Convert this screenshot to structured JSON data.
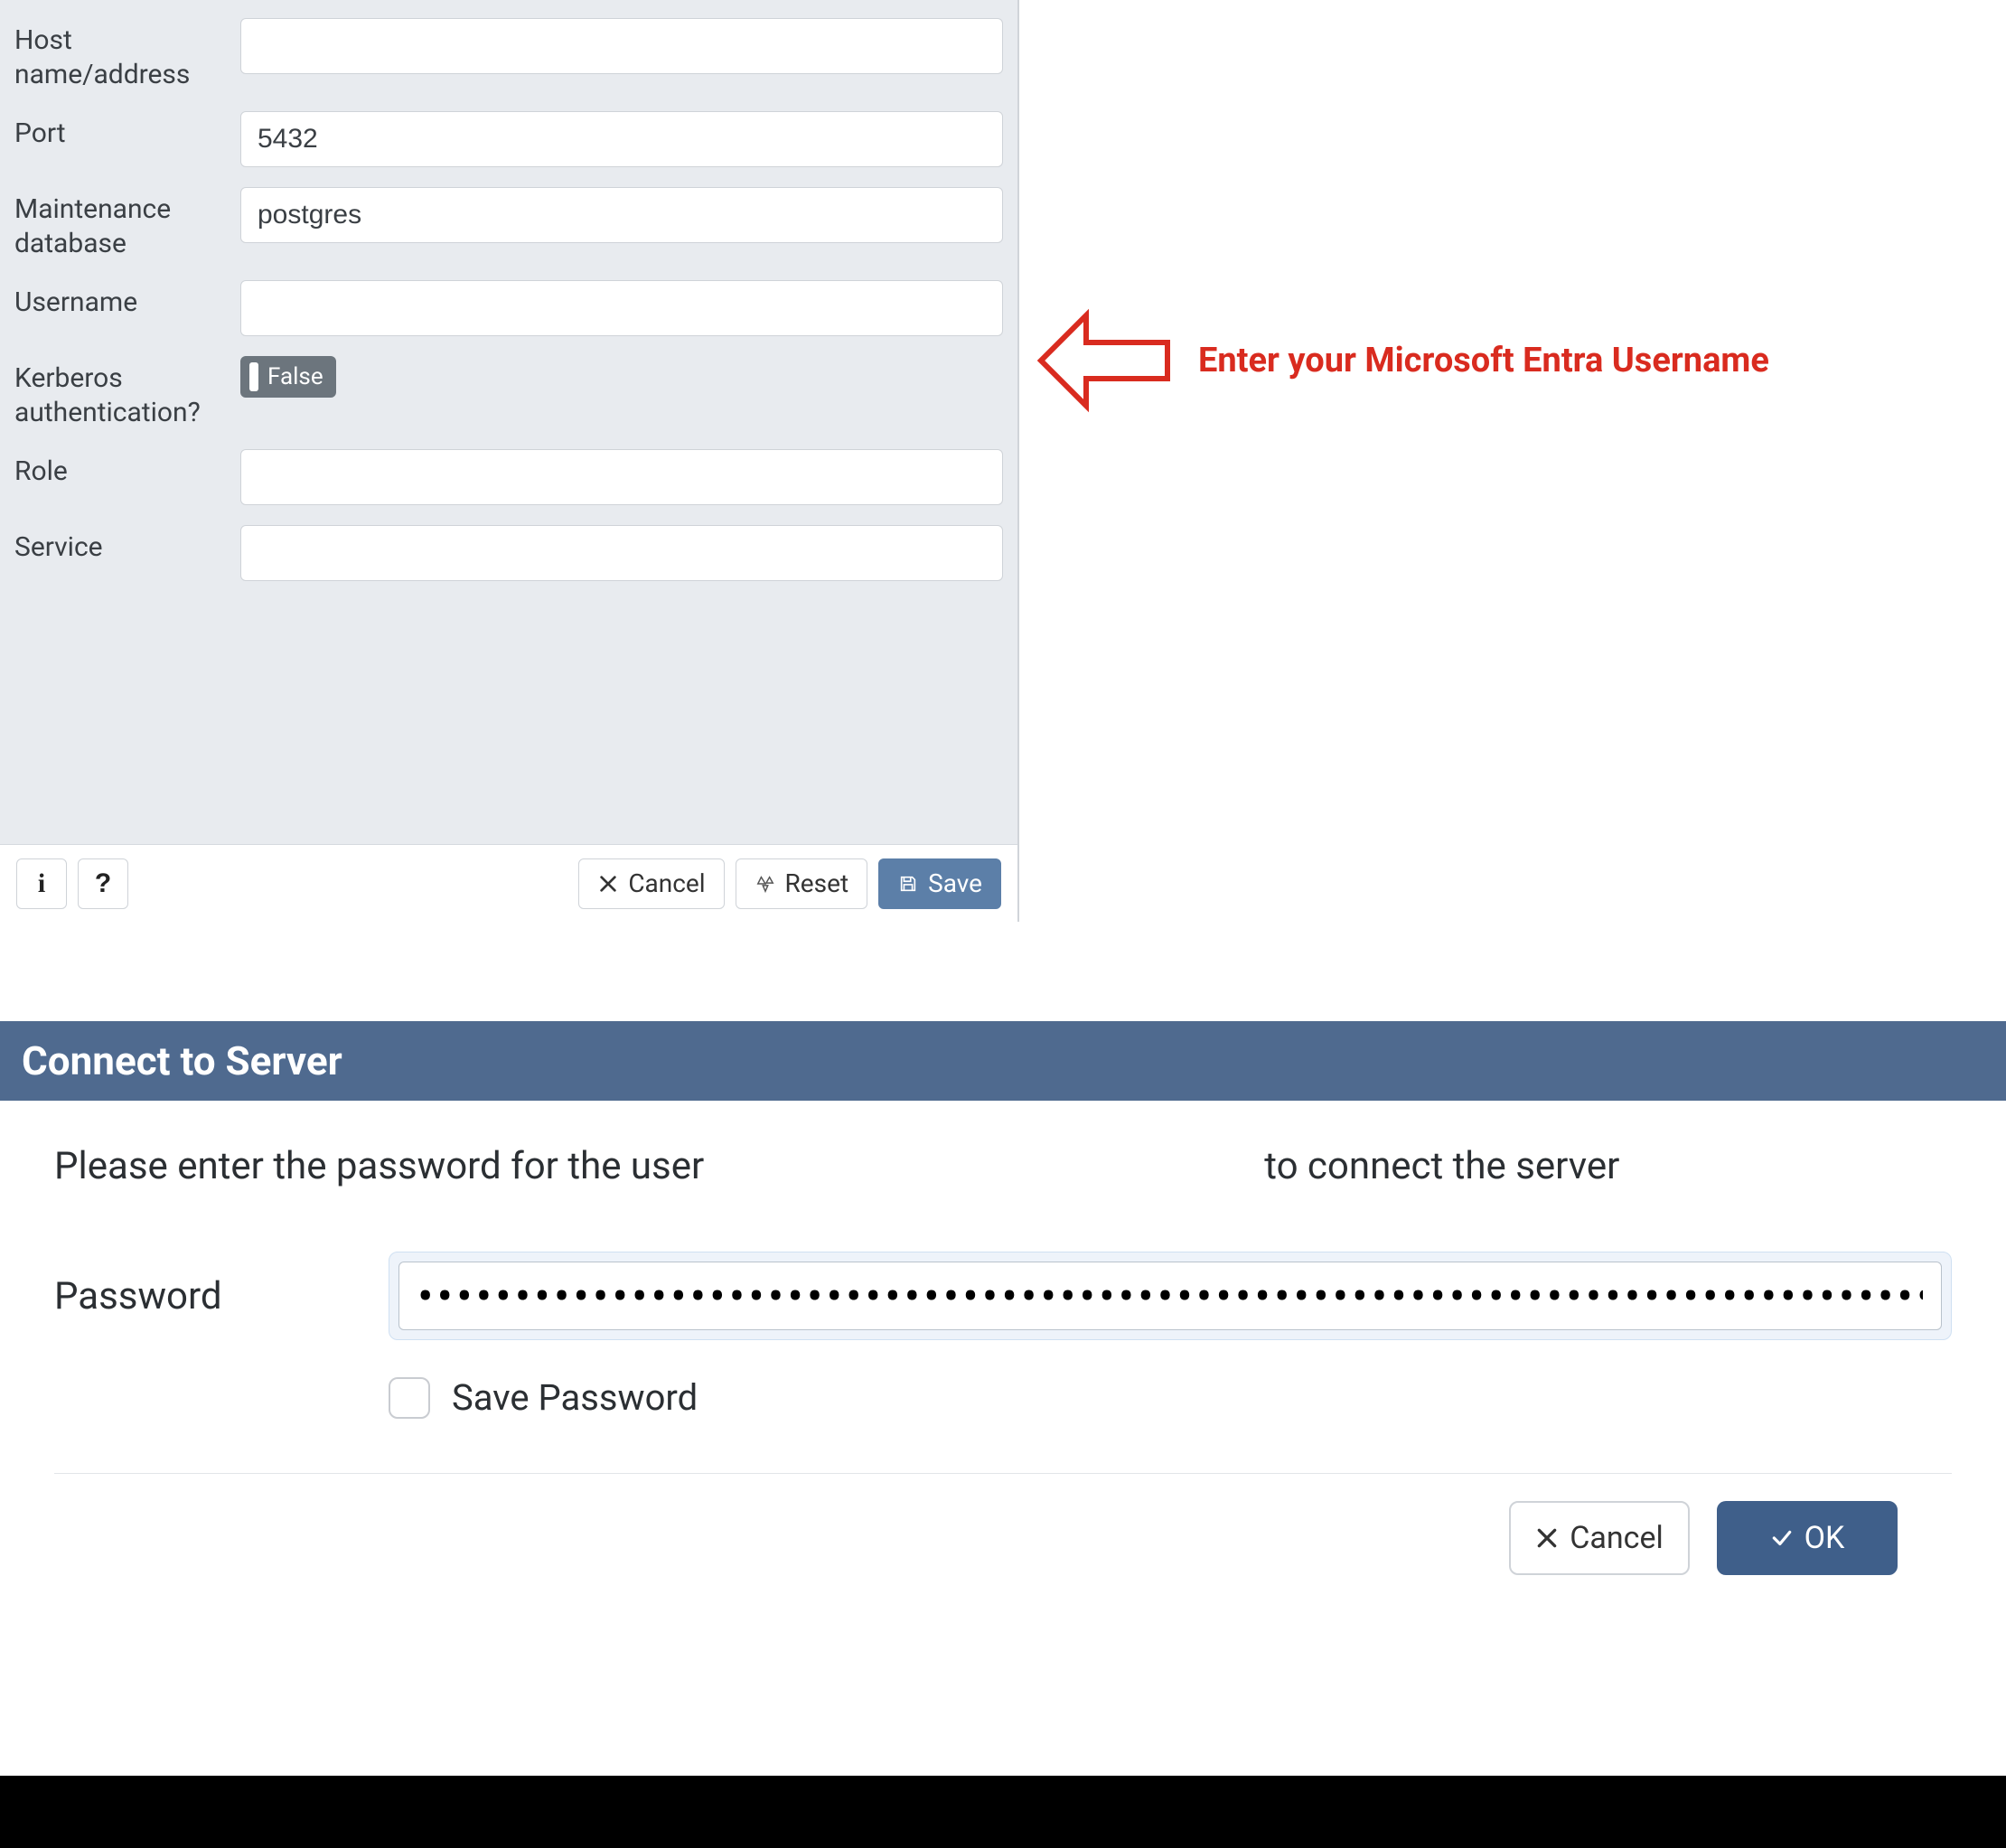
{
  "form": {
    "host_label": "Host name/address",
    "host_value": "",
    "port_label": "Port",
    "port_value": "5432",
    "maintdb_label": "Maintenance database",
    "maintdb_value": "postgres",
    "username_label": "Username",
    "username_value": "",
    "kerberos_label": "Kerberos authentication?",
    "kerberos_value": "False",
    "role_label": "Role",
    "role_value": "",
    "service_label": "Service",
    "service_value": ""
  },
  "footer": {
    "info_label": "i",
    "help_label": "?",
    "cancel_label": "Cancel",
    "reset_label": "Reset",
    "save_label": "Save"
  },
  "callout": {
    "text": "Enter your Microsoft Entra Username"
  },
  "modal": {
    "title": "Connect to Server",
    "prompt_prefix": "Please enter the password for the user",
    "prompt_suffix": "to connect the server",
    "password_label": "Password",
    "password_value": "•••••••••••••••••••••••••••••••••••••••••••••••••••••••••••••••••••••••••••••••••••••••",
    "save_pw_label": "Save Password",
    "cancel_label": "Cancel",
    "ok_label": "OK"
  }
}
